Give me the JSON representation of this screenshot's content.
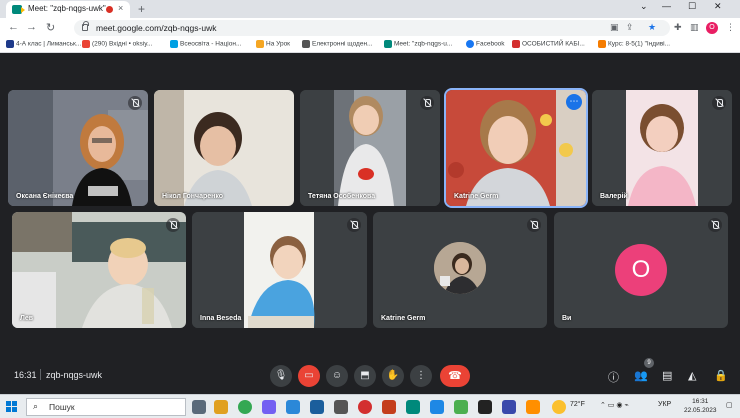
{
  "browser": {
    "tab_title": "Meet: \"zqb-nqgs-uwk\"",
    "tab_close": "×",
    "new_tab": "+",
    "window_controls": [
      "⌄",
      "—",
      "☐",
      "✕"
    ],
    "url": "meet.google.com/zqb-nqgs-uwk",
    "profile_initial": "O",
    "bookmarks": [
      {
        "label": "4-А клас | Лиманськ...",
        "color": "#1e3a8a"
      },
      {
        "label": "(290) Вхідні • oksiy...",
        "color": "#ea4335"
      },
      {
        "label": "Всеосвіта - Націон...",
        "color": "#00a0e3"
      },
      {
        "label": "На Урок",
        "color": "#f5a623"
      },
      {
        "label": "Електронні щоден...",
        "color": "#555555"
      },
      {
        "label": "Meet: \"zqb-nqgs-u...",
        "color": "#00897b"
      },
      {
        "label": "Facebook",
        "color": "#1877f2"
      },
      {
        "label": "ОСОБИСТИЙ КАБІ...",
        "color": "#d32f2f"
      },
      {
        "label": "Курс: 8-5(1) \"Індиві...",
        "color": "#f57c00"
      }
    ]
  },
  "meet": {
    "participants": [
      {
        "name": "Оксана Єнікеєва",
        "muted": true
      },
      {
        "name": "Нікол Гончаренко",
        "muted": false
      },
      {
        "name": "Тетяна Особенкова",
        "muted": true
      },
      {
        "name": "Katrine Germ",
        "muted": false,
        "active": true
      },
      {
        "name": "Валерій",
        "muted": true
      },
      {
        "name": "Лев",
        "muted": true
      },
      {
        "name": "Inna Beseda",
        "muted": true
      },
      {
        "name": "Katrine Germ",
        "muted": true
      },
      {
        "name": "Ви",
        "muted": true,
        "avatar_initial": "O"
      }
    ],
    "more_options": "⋯",
    "clock": "16:31",
    "meeting_code": "zqb-nqgs-uwk",
    "people_count": "9"
  },
  "taskbar": {
    "search_placeholder": "Пошук",
    "weather": "72°F",
    "language": "УКР",
    "time": "16:31",
    "date": "22.05.2023"
  }
}
